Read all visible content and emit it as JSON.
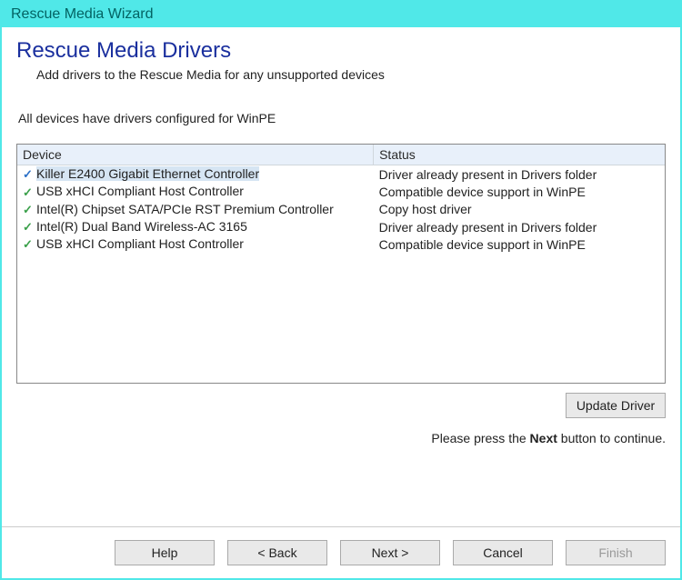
{
  "window": {
    "title": "Rescue Media Wizard"
  },
  "header": {
    "title": "Rescue Media Drivers",
    "subtitle": "Add drivers to the Rescue Media for any unsupported devices"
  },
  "status_line": "All devices have drivers configured for WinPE",
  "table": {
    "columns": {
      "device": "Device",
      "status": "Status"
    },
    "rows": [
      {
        "check": "blue",
        "device": "Killer E2400 Gigabit Ethernet Controller",
        "status": "Driver already present in Drivers folder",
        "selected": true
      },
      {
        "check": "green",
        "device": "USB xHCI Compliant Host Controller",
        "status": "Compatible device support in WinPE",
        "selected": false
      },
      {
        "check": "green",
        "device": "Intel(R) Chipset SATA/PCIe RST Premium Controller",
        "status": "Copy host driver",
        "selected": false
      },
      {
        "check": "green",
        "device": "Intel(R) Dual Band Wireless-AC 3165",
        "status": "Driver already present in Drivers folder",
        "selected": false
      },
      {
        "check": "green",
        "device": "USB xHCI Compliant Host Controller",
        "status": "Compatible device support in WinPE",
        "selected": false
      }
    ]
  },
  "buttons": {
    "update_driver": "Update Driver",
    "help": "Help",
    "back": "< Back",
    "next": "Next >",
    "cancel": "Cancel",
    "finish": "Finish"
  },
  "prompt": {
    "prefix": "Please press the ",
    "bold": "Next",
    "suffix": " button to continue."
  }
}
